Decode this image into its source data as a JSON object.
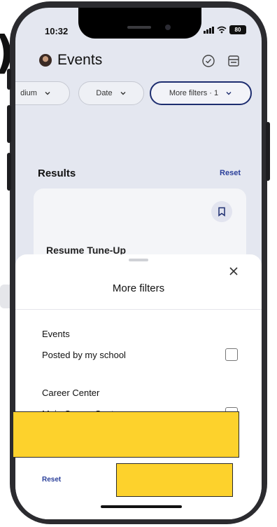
{
  "status_bar": {
    "time": "10:32",
    "battery": "80"
  },
  "header": {
    "title": "Events",
    "check_icon": "check-circle-icon",
    "list_icon": "list-panel-icon",
    "avatar": "user-avatar"
  },
  "filter_chips": [
    {
      "label": "dium"
    },
    {
      "label": "Date"
    },
    {
      "label": "More filters · 1"
    }
  ],
  "results": {
    "label": "Results",
    "reset": "Reset"
  },
  "card": {
    "title": "Resume Tune-Up",
    "bookmark_icon": "bookmark-icon"
  },
  "sheet": {
    "title": "More filters",
    "close_icon": "close-icon",
    "sections": [
      {
        "heading": "Events",
        "options": [
          {
            "label": "Posted by my school",
            "checked": false
          }
        ]
      },
      {
        "heading": "Career Center",
        "options": [
          {
            "label": "Main Career Center",
            "checked": false
          }
        ]
      }
    ],
    "footer_reset": "Reset"
  },
  "colors": {
    "accent": "#2a3f9a",
    "chip_active_border": "#1e2e70",
    "redaction": "#fdd22c"
  }
}
